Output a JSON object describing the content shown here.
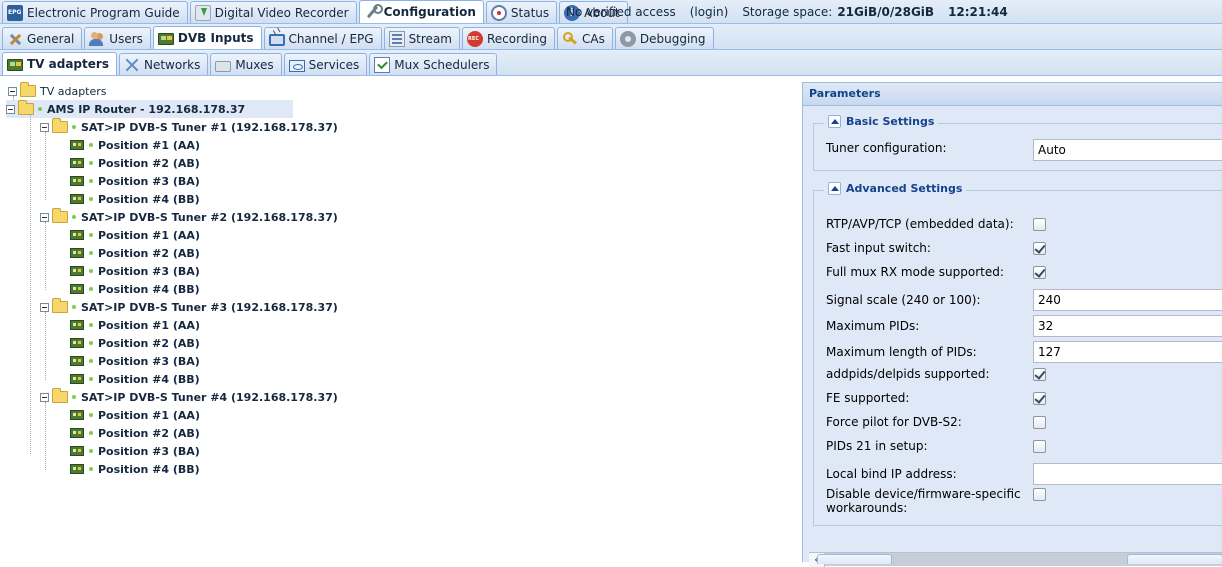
{
  "top_tabs": [
    {
      "label": "Electronic Program Guide",
      "icon": "epg-icon"
    },
    {
      "label": "Digital Video Recorder",
      "icon": "dvr-icon"
    },
    {
      "label": "Configuration",
      "icon": "wrench-icon",
      "active": true
    },
    {
      "label": "Status",
      "icon": "status-icon"
    },
    {
      "label": "About",
      "icon": "info-icon"
    }
  ],
  "status": {
    "access": "No verified access",
    "login": "(login)",
    "storage_label": "Storage space:",
    "storage_value": "21GiB/0/28GiB",
    "clock": "12:21:44"
  },
  "config_tabs": [
    {
      "label": "General",
      "icon": "general-icon"
    },
    {
      "label": "Users",
      "icon": "users-icon"
    },
    {
      "label": "DVB Inputs",
      "icon": "card-icon",
      "active": true
    },
    {
      "label": "Channel / EPG",
      "icon": "tv-icon"
    },
    {
      "label": "Stream",
      "icon": "stream-icon"
    },
    {
      "label": "Recording",
      "icon": "rec-icon"
    },
    {
      "label": "CAs",
      "icon": "key-icon"
    },
    {
      "label": "Debugging",
      "icon": "debug-icon"
    }
  ],
  "dvb_tabs": [
    {
      "label": "TV adapters",
      "icon": "card-icon",
      "active": true
    },
    {
      "label": "Networks",
      "icon": "networks-icon"
    },
    {
      "label": "Muxes",
      "icon": "muxes-icon"
    },
    {
      "label": "Services",
      "icon": "services-icon"
    },
    {
      "label": "Mux Schedulers",
      "icon": "scheduler-icon"
    }
  ],
  "tree": {
    "root": "TV adapters",
    "device": "AMS IP Router - 192.168.178.37",
    "tuners": [
      {
        "label": "SAT>IP DVB-S Tuner #1 (192.168.178.37)",
        "positions": [
          "Position #1 (AA)",
          "Position #2 (AB)",
          "Position #3 (BA)",
          "Position #4 (BB)"
        ]
      },
      {
        "label": "SAT>IP DVB-S Tuner #2 (192.168.178.37)",
        "positions": [
          "Position #1 (AA)",
          "Position #2 (AB)",
          "Position #3 (BA)",
          "Position #4 (BB)"
        ]
      },
      {
        "label": "SAT>IP DVB-S Tuner #3 (192.168.178.37)",
        "positions": [
          "Position #1 (AA)",
          "Position #2 (AB)",
          "Position #3 (BA)",
          "Position #4 (BB)"
        ]
      },
      {
        "label": "SAT>IP DVB-S Tuner #4 (192.168.178.37)",
        "positions": [
          "Position #1 (AA)",
          "Position #2 (AB)",
          "Position #3 (BA)",
          "Position #4 (BB)"
        ]
      }
    ]
  },
  "params": {
    "title": "Parameters",
    "basic": {
      "title": "Basic Settings",
      "tuner_config_label": "Tuner configuration:",
      "tuner_config_value": "Auto"
    },
    "advanced": {
      "title": "Advanced Settings",
      "fields": [
        {
          "label": "RTP/AVP/TCP (embedded data):",
          "type": "checkbox",
          "checked": false
        },
        {
          "label": "Fast input switch:",
          "type": "checkbox",
          "checked": true
        },
        {
          "label": "Full mux RX mode supported:",
          "type": "checkbox",
          "checked": true
        },
        {
          "label": "Signal scale (240 or 100):",
          "type": "text",
          "value": "240"
        },
        {
          "label": "Maximum PIDs:",
          "type": "text",
          "value": "32"
        },
        {
          "label": "Maximum length of PIDs:",
          "type": "text",
          "value": "127"
        },
        {
          "label": "addpids/delpids supported:",
          "type": "checkbox",
          "checked": true
        },
        {
          "label": "FE supported:",
          "type": "checkbox",
          "checked": true
        },
        {
          "label": "Force pilot for DVB-S2:",
          "type": "checkbox",
          "checked": false
        },
        {
          "label": "PIDs 21 in setup:",
          "type": "checkbox",
          "checked": false
        },
        {
          "label": "Local bind IP address:",
          "type": "text",
          "value": ""
        },
        {
          "label": "Disable device/firmware-specific workarounds:",
          "type": "checkbox",
          "checked": false
        }
      ]
    }
  }
}
